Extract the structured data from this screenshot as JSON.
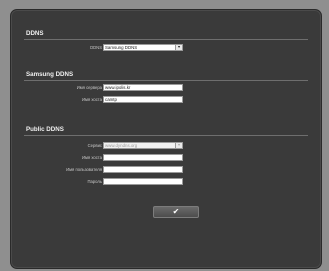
{
  "ddns_section": {
    "title": "DDNS",
    "ddns_label": "DDNS",
    "ddns_value": "Samsung DDNS"
  },
  "samsung_section": {
    "title": "Samsung DDNS",
    "server_label": "Имя сервера",
    "server_value": "www.ipolis.kr",
    "host_label": "Имя хоста",
    "host_value": "camtp"
  },
  "public_section": {
    "title": "Public DDNS",
    "service_label": "Сервис",
    "service_value": "www.dyndns.org",
    "host_label": "Имя хоста",
    "host_value": "",
    "user_label": "Имя пользователя",
    "user_value": "",
    "password_label": "Пароль",
    "password_value": ""
  },
  "apply_button": {
    "label": "✔"
  }
}
